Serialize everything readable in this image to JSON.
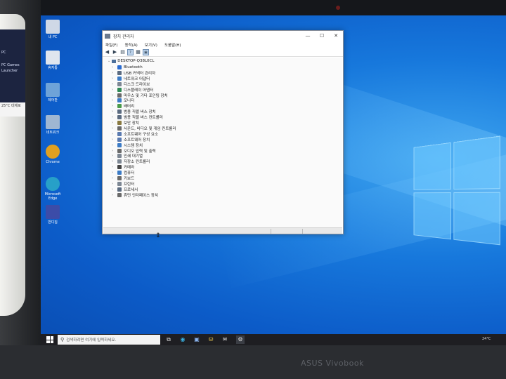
{
  "laptop": {
    "brand": "ASUS Vivobook"
  },
  "left_device": {
    "lines": [
      "PC",
      "PC Games",
      "Launcher"
    ],
    "badge": "25°C\n대체로"
  },
  "desktop_icons": [
    {
      "name": "recycle-bin",
      "label": "내 PC",
      "color": "#cfd8e6"
    },
    {
      "name": "recycle-bin-2",
      "label": "휴지통",
      "color": "#dfe5ee"
    },
    {
      "name": "control-panel",
      "label": "제어판",
      "color": "#6ea3d8"
    },
    {
      "name": "network",
      "label": "네트워크",
      "color": "#9fb7d2"
    },
    {
      "name": "chrome",
      "label": "Chrome",
      "color": "#e0a020"
    },
    {
      "name": "edge",
      "label": "Microsoft Edge",
      "color": "#27a0c8"
    },
    {
      "name": "app",
      "label": "반디집",
      "color": "#3c4ca8"
    }
  ],
  "window": {
    "title": "장치 관리자",
    "controls": {
      "minimize": "—",
      "maximize": "☐",
      "close": "✕"
    },
    "menu": [
      "파일(F)",
      "동작(A)",
      "보기(V)",
      "도움말(H)"
    ],
    "toolbar_icons": [
      "◀",
      "▶",
      "▤",
      "?",
      "▦",
      "▣"
    ],
    "root": "DESKTOP-Q38L0CL",
    "nodes": [
      {
        "label": "Bluetooth",
        "color": "#2a6bd0"
      },
      {
        "label": "USB 커넥터 관리자",
        "color": "#5b6b80"
      },
      {
        "label": "네트워크 어댑터",
        "color": "#3b7bc6"
      },
      {
        "label": "디스크 드라이브",
        "color": "#7d8793"
      },
      {
        "label": "디스플레이 어댑터",
        "color": "#2e8a55"
      },
      {
        "label": "마우스 및 기타 포인팅 장치",
        "color": "#6a6a6a"
      },
      {
        "label": "모니터",
        "color": "#3b7bc6"
      },
      {
        "label": "배터리",
        "color": "#4a9b4a"
      },
      {
        "label": "범용 직렬 버스 장치",
        "color": "#5b6b80"
      },
      {
        "label": "범용 직렬 버스 컨트롤러",
        "color": "#5b6b80"
      },
      {
        "label": "보안 장치",
        "color": "#8a7a40"
      },
      {
        "label": "사운드, 비디오 및 게임 컨트롤러",
        "color": "#6a6a6a"
      },
      {
        "label": "소프트웨어 구성 요소",
        "color": "#5a7ab0"
      },
      {
        "label": "소프트웨어 장치",
        "color": "#5a7ab0"
      },
      {
        "label": "시스템 장치",
        "color": "#3b7bc6"
      },
      {
        "label": "오디오 입력 및 출력",
        "color": "#6a6a6a"
      },
      {
        "label": "인쇄 대기열",
        "color": "#7d8793"
      },
      {
        "label": "저장소 컨트롤러",
        "color": "#7d8793"
      },
      {
        "label": "카메라",
        "color": "#444"
      },
      {
        "label": "컴퓨터",
        "color": "#3b7bc6"
      },
      {
        "label": "키보드",
        "color": "#6a6a6a"
      },
      {
        "label": "프린터",
        "color": "#7d8793"
      },
      {
        "label": "프로세서",
        "color": "#5b6b80"
      },
      {
        "label": "휴먼 인터페이스 장치",
        "color": "#6a6a6a"
      }
    ]
  },
  "taskbar": {
    "search_placeholder": "검색하려면 여기에 입력하세요.",
    "apps": [
      "⧉",
      "◉",
      "▣",
      "⛁",
      "✉",
      "⚙"
    ],
    "weather": "24°C"
  }
}
